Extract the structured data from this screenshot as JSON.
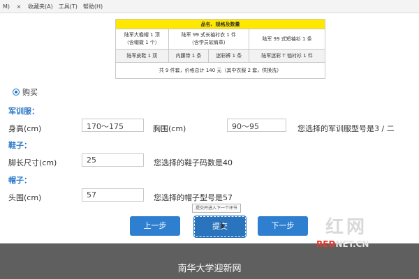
{
  "menubar": {
    "items": [
      "M)",
      "收藏夹(A)",
      "工具(T)",
      "帮助(H)"
    ],
    "close": "×"
  },
  "spec_table": {
    "title": "品名、规格及数量",
    "row1": [
      [
        "陆军大檐帽 1 顶",
        "（含帽徽 1 个）"
      ],
      [
        "陆军 99 式长袖衬衣 1 件",
        "（含学员软肩章）"
      ],
      [
        "陆军 99 式短袖衫 1 条"
      ]
    ],
    "row2": [
      "陆军皮鞋 1 双",
      "内腰带 1 条",
      "迷彩裤 1 条",
      "陆军迷彩 T 恤衬衫 1 件"
    ],
    "total": "共 9 件套，价格总计 140 元（其中衣服 2 套，供换洗）"
  },
  "purchase": {
    "label": "购买"
  },
  "uniform": {
    "heading": "军训服：",
    "height_label": "身高(cm)",
    "height_value": "170～175",
    "chest_label": "胸围(cm)",
    "chest_value": "90～95",
    "result": "您选择的军训服型号是3 / 二"
  },
  "shoes": {
    "heading": "鞋子：",
    "foot_label": "脚长尺寸(cm)",
    "foot_value": "25",
    "result": "您选择的鞋子码数是40"
  },
  "hat": {
    "heading": "帽子：",
    "head_label": "头围(cm)",
    "head_value": "57",
    "result": "您选择的帽子型号是57"
  },
  "buttons": {
    "prev": "上一步",
    "submit": "提交",
    "next": "下一步"
  },
  "tooltip": "提交并进入下一个环节",
  "watermark": {
    "logo": "红网",
    "sub_red": "RED",
    "sub_rest": "NET.CN"
  },
  "footer": {
    "caption": "南华大学迎新网"
  },
  "colors": {
    "section": "#2a78c9",
    "button": "#2e7fcf",
    "highlight": "#ffe800",
    "footer": "#5f5f5f"
  }
}
